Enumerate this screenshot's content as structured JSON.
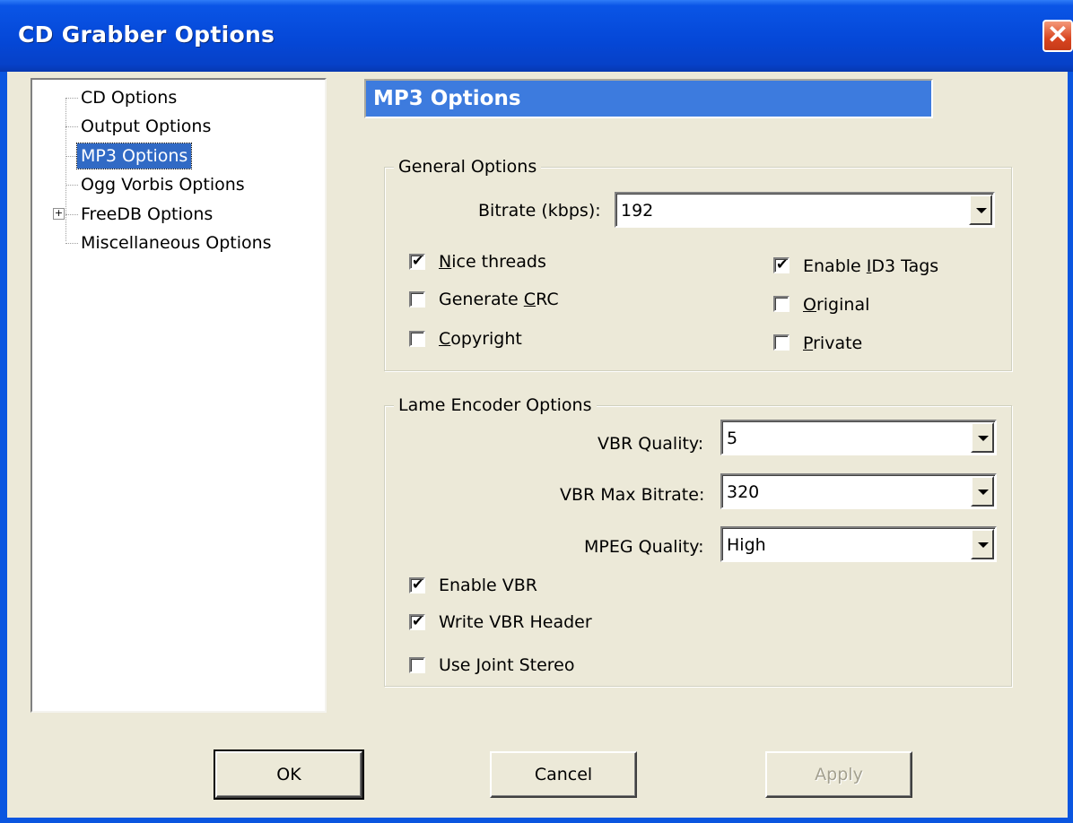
{
  "window": {
    "title": "CD Grabber Options",
    "close_label": "✕"
  },
  "tree": {
    "items": [
      {
        "label": "CD Options"
      },
      {
        "label": "Output Options"
      },
      {
        "label": "MP3 Options"
      },
      {
        "label": "Ogg Vorbis Options"
      },
      {
        "label": "FreeDB Options",
        "expander": "+"
      },
      {
        "label": "Miscellaneous Options"
      }
    ],
    "selected": "MP3 Options"
  },
  "page": {
    "header": "MP3 Options"
  },
  "general": {
    "legend": "General Options",
    "bitrate_label": "Bitrate (kbps):",
    "bitrate_value": "192",
    "nice_threads": {
      "pre": "",
      "key": "N",
      "post": "ice threads",
      "checked": true
    },
    "generate_crc": {
      "pre": "Generate ",
      "key": "C",
      "post": "RC",
      "checked": false
    },
    "copyright": {
      "pre": "",
      "key": "C",
      "post": "opyright",
      "checked": false
    },
    "enable_id3": {
      "pre": "Enable ",
      "key": "I",
      "post": "D3 Tags",
      "checked": true
    },
    "original": {
      "pre": "",
      "key": "O",
      "post": "riginal",
      "checked": false
    },
    "private": {
      "pre": "",
      "key": "P",
      "post": "rivate",
      "checked": false
    }
  },
  "lame": {
    "legend": "Lame Encoder Options",
    "vbr_quality_label": "VBR Quality:",
    "vbr_quality_value": "5",
    "vbr_max_label": "VBR Max Bitrate:",
    "vbr_max_value": "320",
    "mpeg_quality_label": "MPEG Quality:",
    "mpeg_quality_value": "High",
    "enable_vbr": {
      "label": "Enable VBR",
      "checked": true
    },
    "write_vbr_header": {
      "label": "Write VBR Header",
      "checked": true
    },
    "joint_stereo": {
      "label": "Use Joint Stereo",
      "checked": false
    }
  },
  "buttons": {
    "ok": "OK",
    "cancel": "Cancel",
    "apply": "Apply"
  },
  "check_glyph": "✔",
  "colors": {
    "titlebar": "#0548d8",
    "selection": "#316ac5",
    "dialog_bg": "#ece9d8"
  }
}
